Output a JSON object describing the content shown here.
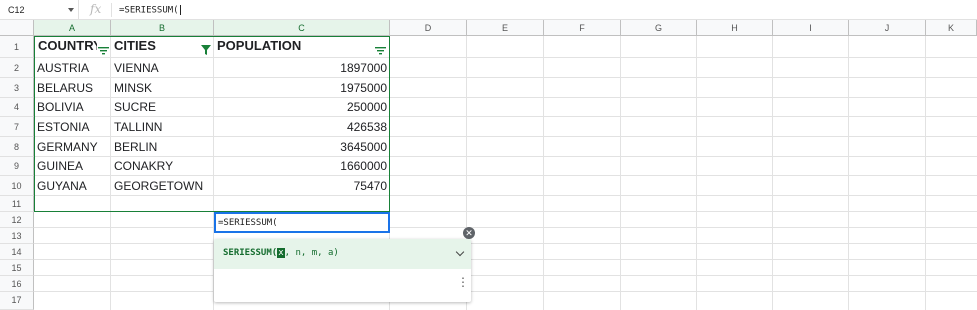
{
  "formula_bar": {
    "name_box": "C12",
    "fx_icon": "fx-icon",
    "formula": "=SERIESSUM("
  },
  "columns": [
    "A",
    "B",
    "C",
    "D",
    "E",
    "F",
    "G",
    "H",
    "I",
    "J",
    "K"
  ],
  "rows": [
    "1",
    "2",
    "3",
    "4",
    "7",
    "8",
    "9",
    "10",
    "11",
    "12",
    "13",
    "14",
    "15",
    "16",
    "17"
  ],
  "table": {
    "headers": [
      "COUNTRY",
      "CITIES",
      "POPULATION"
    ],
    "records": [
      [
        "AUSTRIA",
        "VIENNA",
        "1897000"
      ],
      [
        "BELARUS",
        "MINSK",
        "1975000"
      ],
      [
        "BOLIVIA",
        "SUCRE",
        "250000"
      ],
      [
        "ESTONIA",
        "TALLINN",
        "426538"
      ],
      [
        "GERMANY",
        "BERLIN",
        "3645000"
      ],
      [
        "GUINEA",
        "CONAKRY",
        "1660000"
      ],
      [
        "GUYANA",
        "GEORGETOWN",
        "75470"
      ]
    ]
  },
  "active_cell": {
    "value": "=SERIESSUM("
  },
  "suggestion": {
    "function_name": "SERIESSUM(",
    "current_arg": "x",
    "rest_args": ", n, m, a)",
    "close_icon": "close-icon",
    "expand_icon": "chevron-down-icon",
    "more_icon": "more-vert-icon"
  },
  "colors": {
    "table_border": "#188038",
    "selection_blue": "#1a73e8",
    "suggest_green_bg": "#e6f4ea",
    "suggest_green_text": "#146c2e"
  }
}
